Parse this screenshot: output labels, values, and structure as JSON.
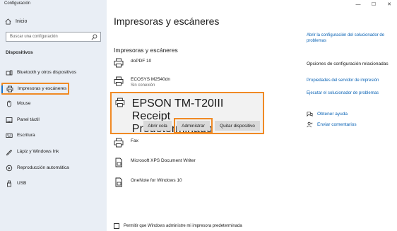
{
  "window": {
    "app_title": "Configuración",
    "controls": {
      "minimize": "—",
      "maximize": "☐",
      "close": "✕"
    }
  },
  "sidebar": {
    "home_label": "Inicio",
    "search_placeholder": "Buscar una configuración",
    "section_label": "Dispositivos",
    "items": [
      {
        "label": "Bluetooth y otros dispositivos",
        "icon": "bluetooth-icon"
      },
      {
        "label": "Impresoras y escáneres",
        "icon": "printer-icon",
        "selected": true
      },
      {
        "label": "Mouse",
        "icon": "mouse-icon"
      },
      {
        "label": "Panel táctil",
        "icon": "touchpad-icon"
      },
      {
        "label": "Escritura",
        "icon": "keyboard-icon"
      },
      {
        "label": "Lápiz y Windows Ink",
        "icon": "pen-icon"
      },
      {
        "label": "Reproducción automática",
        "icon": "autoplay-icon"
      },
      {
        "label": "USB",
        "icon": "usb-icon"
      }
    ]
  },
  "main": {
    "title": "Impresoras y escáneres",
    "subtitle": "Impresoras y escáneres",
    "printers": [
      {
        "name": "doPDF 10",
        "status": ""
      },
      {
        "name": "ECOSYS M2540dn",
        "status": "Sin conexión"
      },
      {
        "name": "EPSON TM-T20III Receipt",
        "status": "Predeterminado",
        "selected": true
      },
      {
        "name": "Fax",
        "status": ""
      },
      {
        "name": "Microsoft XPS Document Writer",
        "status": ""
      },
      {
        "name": "OneNote for Windows 10",
        "status": ""
      }
    ],
    "buttons": {
      "open_queue": "Abrir cola",
      "manage": "Administrar",
      "remove": "Quitar dispositivo"
    },
    "default_checkbox_label": "Permitir que Windows administre mi impresora predeterminada",
    "default_checkbox_checked": false
  },
  "right": {
    "troubleshooter_link": "Abrir la configuración del solucionador de problemas",
    "related_heading": "Opciones de configuración relacionadas",
    "server_props_link": "Propiedades del servidor de impresión",
    "run_troubleshooter_link": "Ejecutar el solucionador de problemas",
    "help_link": "Obtener ayuda",
    "feedback_link": "Enviar comentarios"
  },
  "colors": {
    "sidebar_bg": "#e9eef5",
    "highlight": "#f08a24",
    "link": "#0a63b5",
    "accent": "#1a73c8"
  }
}
